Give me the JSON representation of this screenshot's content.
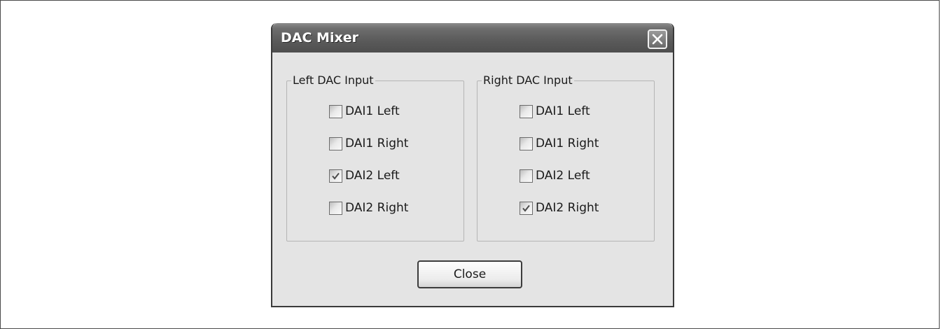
{
  "dialog": {
    "title": "DAC Mixer",
    "close_icon": "close-x-icon",
    "close_button_label": "Close"
  },
  "left_group": {
    "label": "Left DAC Input",
    "items": [
      {
        "label": "DAI1 Left",
        "checked": false
      },
      {
        "label": "DAI1 Right",
        "checked": false
      },
      {
        "label": "DAI2 Left",
        "checked": true
      },
      {
        "label": "DAI2 Right",
        "checked": false
      }
    ]
  },
  "right_group": {
    "label": "Right DAC Input",
    "items": [
      {
        "label": "DAI1 Left",
        "checked": false
      },
      {
        "label": "DAI1 Right",
        "checked": false
      },
      {
        "label": "DAI2 Left",
        "checked": false
      },
      {
        "label": "DAI2 Right",
        "checked": true
      }
    ]
  }
}
